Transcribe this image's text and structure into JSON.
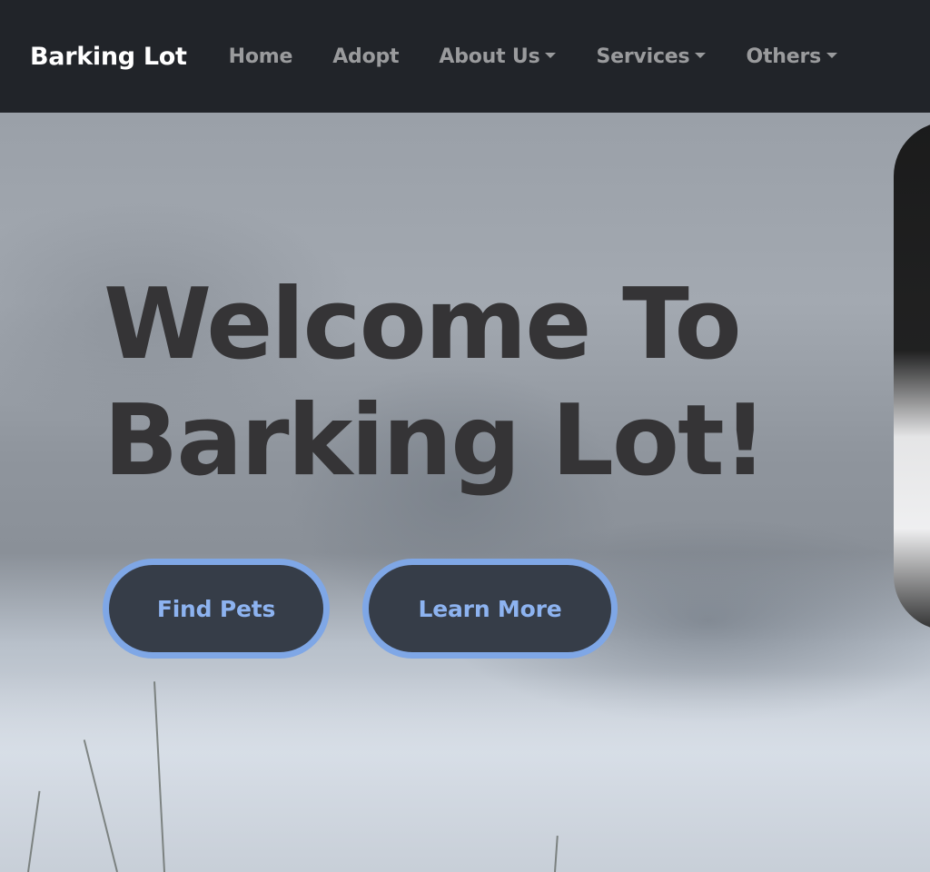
{
  "navbar": {
    "brand": "Barking Lot",
    "items": [
      {
        "label": "Home",
        "dropdown": false
      },
      {
        "label": "Adopt",
        "dropdown": false
      },
      {
        "label": "About Us",
        "dropdown": true
      },
      {
        "label": "Services",
        "dropdown": true
      },
      {
        "label": "Others",
        "dropdown": true
      }
    ]
  },
  "hero": {
    "title_line1": "Welcome To",
    "title_line2": "Barking Lot!",
    "buttons": {
      "find_pets": "Find Pets",
      "learn_more": "Learn More"
    }
  },
  "colors": {
    "navbar_bg": "#212429",
    "nav_text": "#9a9b9d",
    "brand_text": "#ffffff",
    "title_text": "#353436",
    "button_bg": "#363d48",
    "button_border": "#7fa7e6",
    "button_text": "#8db3f0"
  },
  "icons": {
    "dropdown": "caret-down-icon"
  }
}
